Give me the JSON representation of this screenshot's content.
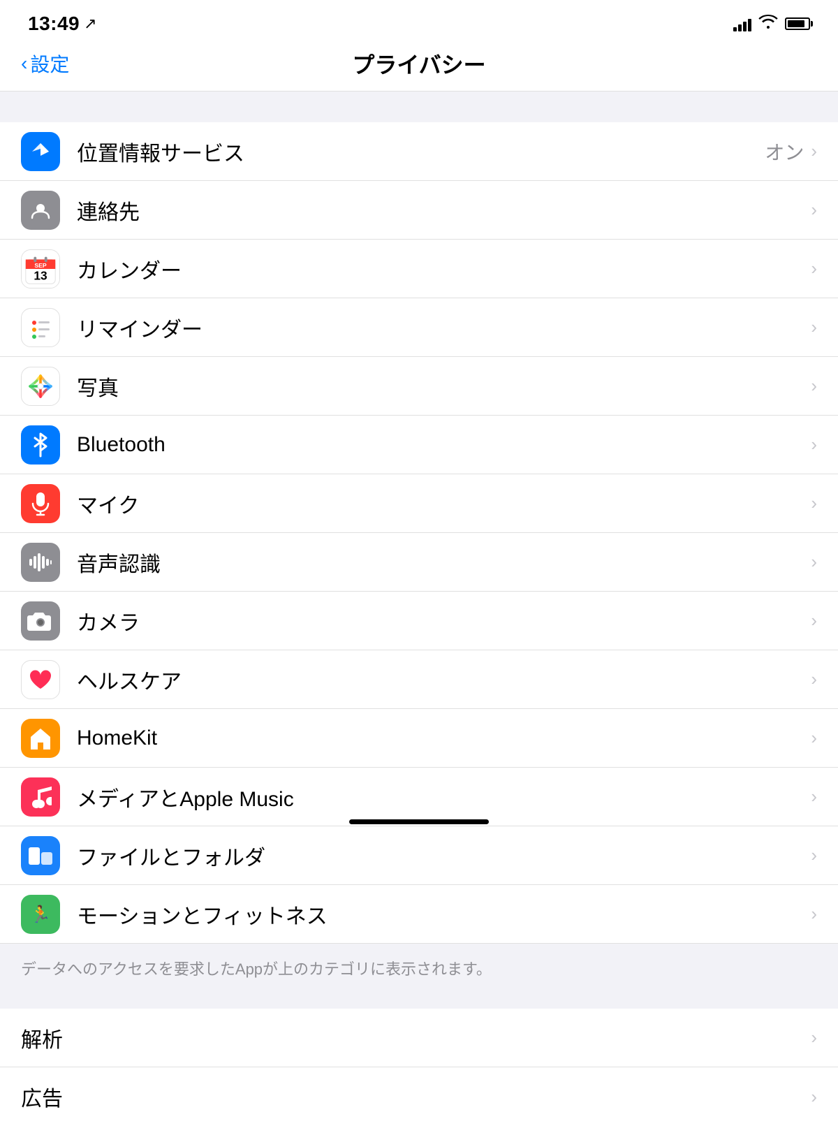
{
  "statusBar": {
    "time": "13:49",
    "locationArrow": "↗"
  },
  "header": {
    "backLabel": "設定",
    "title": "プライバシー"
  },
  "rows": [
    {
      "id": "location",
      "label": "位置情報サービス",
      "value": "オン",
      "iconType": "location",
      "iconBg": "#007aff"
    },
    {
      "id": "contacts",
      "label": "連絡先",
      "value": "",
      "iconType": "contacts",
      "iconBg": "#gray"
    },
    {
      "id": "calendar",
      "label": "カレンダー",
      "value": "",
      "iconType": "calendar",
      "iconBg": "#ffffff"
    },
    {
      "id": "reminders",
      "label": "リマインダー",
      "value": "",
      "iconType": "reminders",
      "iconBg": "#ffffff"
    },
    {
      "id": "photos",
      "label": "写真",
      "value": "",
      "iconType": "photos",
      "iconBg": "#ffffff"
    },
    {
      "id": "bluetooth",
      "label": "Bluetooth",
      "value": "",
      "iconType": "bluetooth",
      "iconBg": "#007aff"
    },
    {
      "id": "microphone",
      "label": "マイク",
      "value": "",
      "iconType": "microphone",
      "iconBg": "#ff3b30"
    },
    {
      "id": "speechrecognition",
      "label": "音声認識",
      "value": "",
      "iconType": "speechrecognition",
      "iconBg": "#8e8e93"
    },
    {
      "id": "camera",
      "label": "カメラ",
      "value": "",
      "iconType": "camera",
      "iconBg": "#8e8e93"
    },
    {
      "id": "health",
      "label": "ヘルスケア",
      "value": "",
      "iconType": "health",
      "iconBg": "#ffffff"
    },
    {
      "id": "homekit",
      "label": "HomeKit",
      "value": "",
      "iconType": "homekit",
      "iconBg": "#ff9500"
    },
    {
      "id": "music",
      "label": "メディアとApple Music",
      "value": "",
      "iconType": "music",
      "iconBg": "#fc3158"
    },
    {
      "id": "files",
      "label": "ファイルとフォルダ",
      "value": "",
      "iconType": "files",
      "iconBg": "#1a82fb"
    },
    {
      "id": "fitness",
      "label": "モーションとフィットネス",
      "value": "",
      "iconType": "fitness",
      "iconBg": "#3dba5f"
    }
  ],
  "footerNote": "データへのアクセスを要求したAppが上のカテゴリに表示されます。",
  "bottomRows": [
    {
      "id": "analytics",
      "label": "解析"
    },
    {
      "id": "advertising",
      "label": "広告"
    }
  ]
}
